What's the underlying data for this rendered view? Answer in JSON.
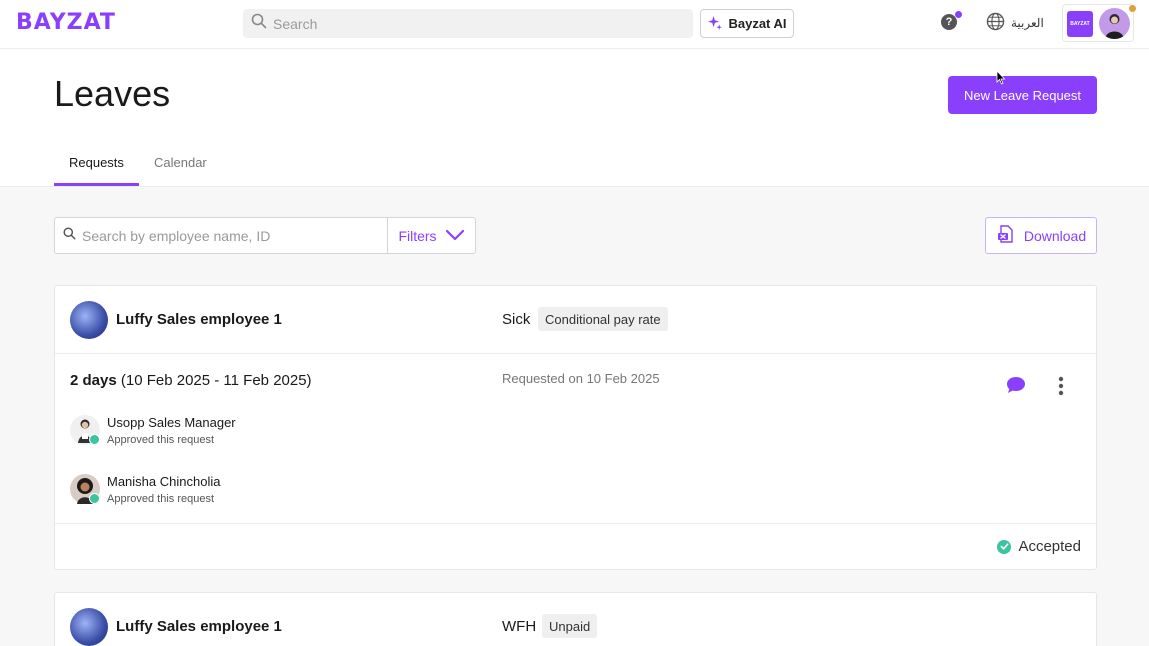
{
  "topbar": {
    "logo": "BAYZAT",
    "search_placeholder": "Search",
    "ai_button_label": "Bayzat AI",
    "help_label": "?",
    "language_label": "العربية",
    "company_logo_text": "BAYZAT",
    "accent_color": "#8a3ffc"
  },
  "page": {
    "title": "Leaves",
    "new_request_label": "New Leave Request",
    "tabs": [
      {
        "label": "Requests",
        "active": true
      },
      {
        "label": "Calendar",
        "active": false
      }
    ]
  },
  "filters": {
    "search_placeholder": "Search by employee name, ID",
    "filters_label": "Filters",
    "download_label": "Download"
  },
  "requests": [
    {
      "employee_name": "Luffy Sales employee 1",
      "leave_type": "Sick",
      "pay_badge": "Conditional pay rate",
      "duration_bold": "2 days",
      "duration_range": "(10 Feb 2025 - 11 Feb 2025)",
      "requested_on": "Requested on 10 Feb 2025",
      "approvers": [
        {
          "name": "Usopp Sales Manager",
          "status": "Approved this request"
        },
        {
          "name": "Manisha Chincholia",
          "status": "Approved this request"
        }
      ],
      "status": "Accepted"
    },
    {
      "employee_name": "Luffy Sales employee 1",
      "leave_type": "WFH",
      "pay_badge": "Unpaid"
    }
  ],
  "icons": {
    "search": "search-icon",
    "ai": "sparkle-icon",
    "help": "help-icon",
    "language": "globe-icon",
    "filter_chevron": "chevron-down-icon",
    "download": "excel-file-icon",
    "comment": "comment-icon",
    "more": "more-vertical-icon",
    "approved": "check-circle-icon"
  },
  "status_color": "#3ac4a0"
}
